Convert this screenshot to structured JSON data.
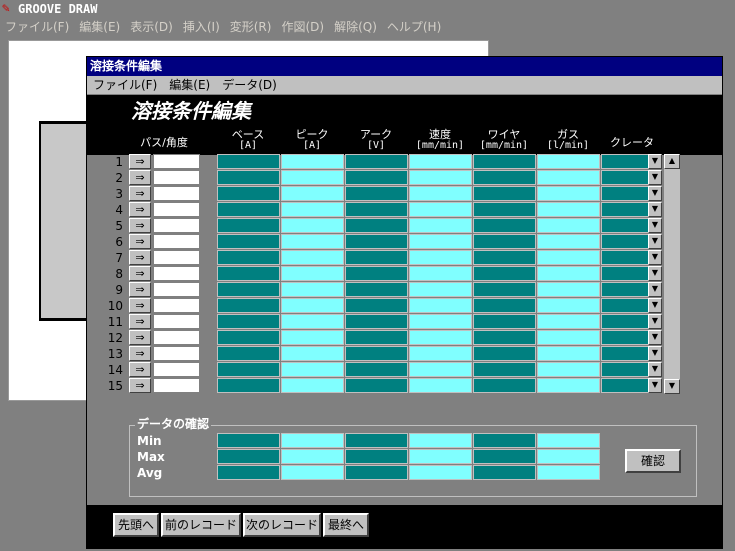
{
  "app": {
    "title": "GROOVE DRAW",
    "menu": [
      "ファイル(F)",
      "編集(E)",
      "表示(D)",
      "挿入(I)",
      "変形(R)",
      "作図(D)",
      "解除(Q)",
      "ヘルプ(H)"
    ]
  },
  "dialog": {
    "title": "溶接条件編集",
    "menu": [
      "ファイル(F)",
      "編集(E)",
      "データ(D)"
    ],
    "form_title": "溶接条件編集",
    "columns": {
      "pass": "パス/角度",
      "base": {
        "label": "ベース",
        "unit": "[A]"
      },
      "peak": {
        "label": "ピーク",
        "unit": "[A]"
      },
      "arc": {
        "label": "アーク",
        "unit": "[V]"
      },
      "speed": {
        "label": "速度",
        "unit": "[mm/min]"
      },
      "wire": {
        "label": "ワイヤ",
        "unit": "[mm/min]"
      },
      "gas": {
        "label": "ガス",
        "unit": "[l/min]"
      },
      "crater": {
        "label": "クレータ",
        "unit": ""
      }
    },
    "rows": [
      "1",
      "2",
      "3",
      "4",
      "5",
      "6",
      "7",
      "8",
      "9",
      "10",
      "11",
      "12",
      "13",
      "14",
      "15"
    ],
    "arrow_symbol": "⇒",
    "confirm": {
      "legend": "データの確認",
      "labels": [
        "Min",
        "Max",
        "Avg"
      ],
      "button": "確認"
    },
    "nav": {
      "first": "先頭へ",
      "prev": "前のレコード",
      "next": "次のレコード",
      "last": "最終へ"
    }
  },
  "colors": {
    "teal": "#008080",
    "cyan": "#80ffff",
    "title_bar": "#000080"
  }
}
